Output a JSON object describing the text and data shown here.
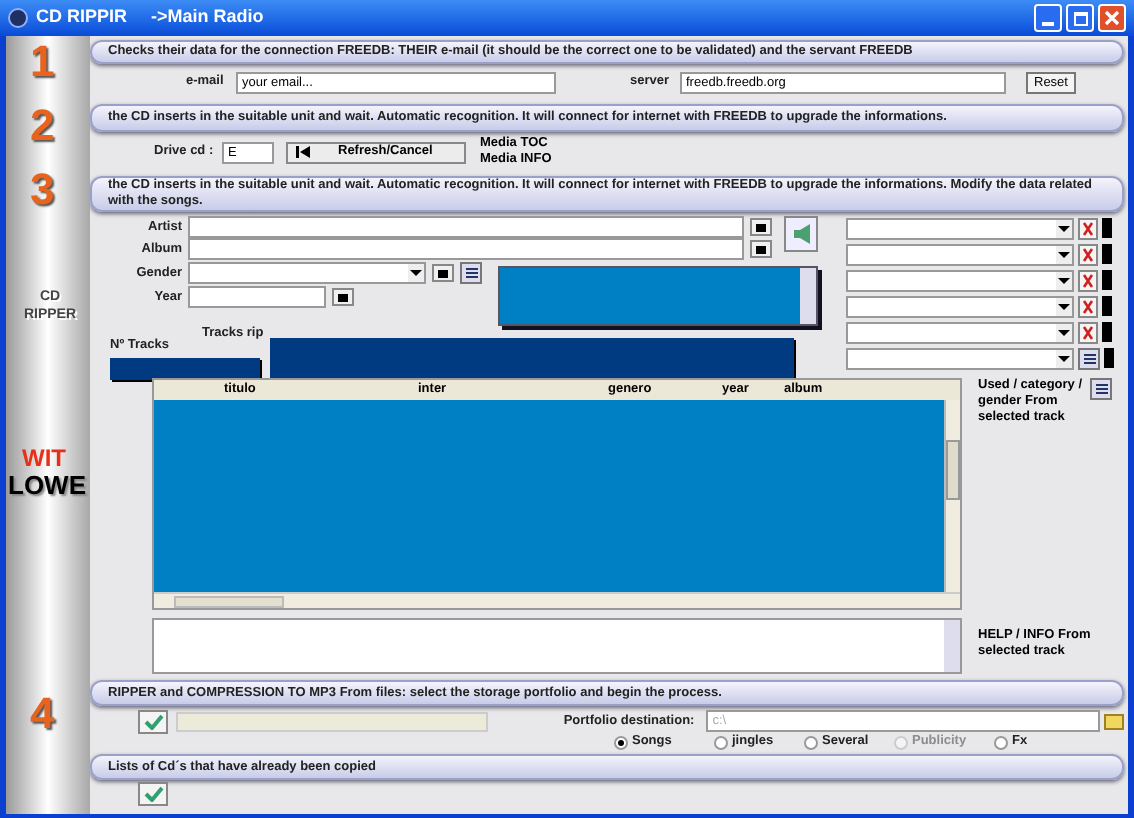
{
  "window": {
    "title": "CD RIPPIR",
    "subtitle": "->Main Radio"
  },
  "sidebar": {
    "caption": "CD RIPPER",
    "logo_top": "WIT",
    "logo_bottom": "LOWE"
  },
  "step1": {
    "number": "1",
    "banner": "Checks their data for the connection FREEDB: THEIR e-mail (it should be the correct one to be validated) and the servant FREEDB",
    "email_label": "e-mail",
    "email_value": "your email...",
    "server_label": "server",
    "server_value": "freedb.freedb.org",
    "reset": "Reset"
  },
  "step2": {
    "number": "2",
    "banner": "the CD inserts in the suitable unit and wait. Automatic recognition. It will connect for internet with FREEDB to upgrade the informations.",
    "drive_label": "Drive cd :",
    "drive_value": "E",
    "refresh": "Refresh/Cancel",
    "media_toc": "Media TOC",
    "media_info": "Media INFO"
  },
  "step3": {
    "number": "3",
    "banner": "the CD inserts in the suitable unit and wait. Automatic recognition. It will connect for internet with FREEDB to upgrade the informations. Modify the data related with the songs.",
    "fields": [
      {
        "label": "Artist",
        "kind": "long"
      },
      {
        "label": "Album",
        "kind": "long"
      },
      {
        "label": "Gender",
        "kind": "combo"
      },
      {
        "label": "Year",
        "kind": "short"
      }
    ],
    "tracks_label": "Nº Tracks",
    "tracks_rip_label": "Tracks rip",
    "side_combos": [
      {
        "kind": "delete"
      },
      {
        "kind": "delete"
      },
      {
        "kind": "delete"
      },
      {
        "kind": "delete"
      },
      {
        "kind": "delete"
      },
      {
        "kind": "add"
      }
    ],
    "table": {
      "columns": [
        "titulo",
        "inter",
        "genero",
        "year",
        "album"
      ]
    },
    "used_label": "Used / category / gender From selected track",
    "help_label": "HELP / INFO From selected track"
  },
  "step4": {
    "number": "4",
    "banner": "RIPPER and COMPRESSION TO MP3 From files: select the storage portfolio and begin the process.",
    "portfolio_label": "Portfolio destination:",
    "portfolio_value": "c:\\",
    "progress": {
      "level": 0
    },
    "options": [
      {
        "label": "Songs",
        "selected": true,
        "disabled": false
      },
      {
        "label": "jingles",
        "selected": false,
        "disabled": false
      },
      {
        "label": "Several",
        "selected": false,
        "disabled": false
      },
      {
        "label": "Publicity",
        "selected": false,
        "disabled": true
      },
      {
        "label": "Fx",
        "selected": false,
        "disabled": false
      }
    ]
  },
  "history": {
    "banner": "Lists of Cd´s that have already been copied"
  }
}
